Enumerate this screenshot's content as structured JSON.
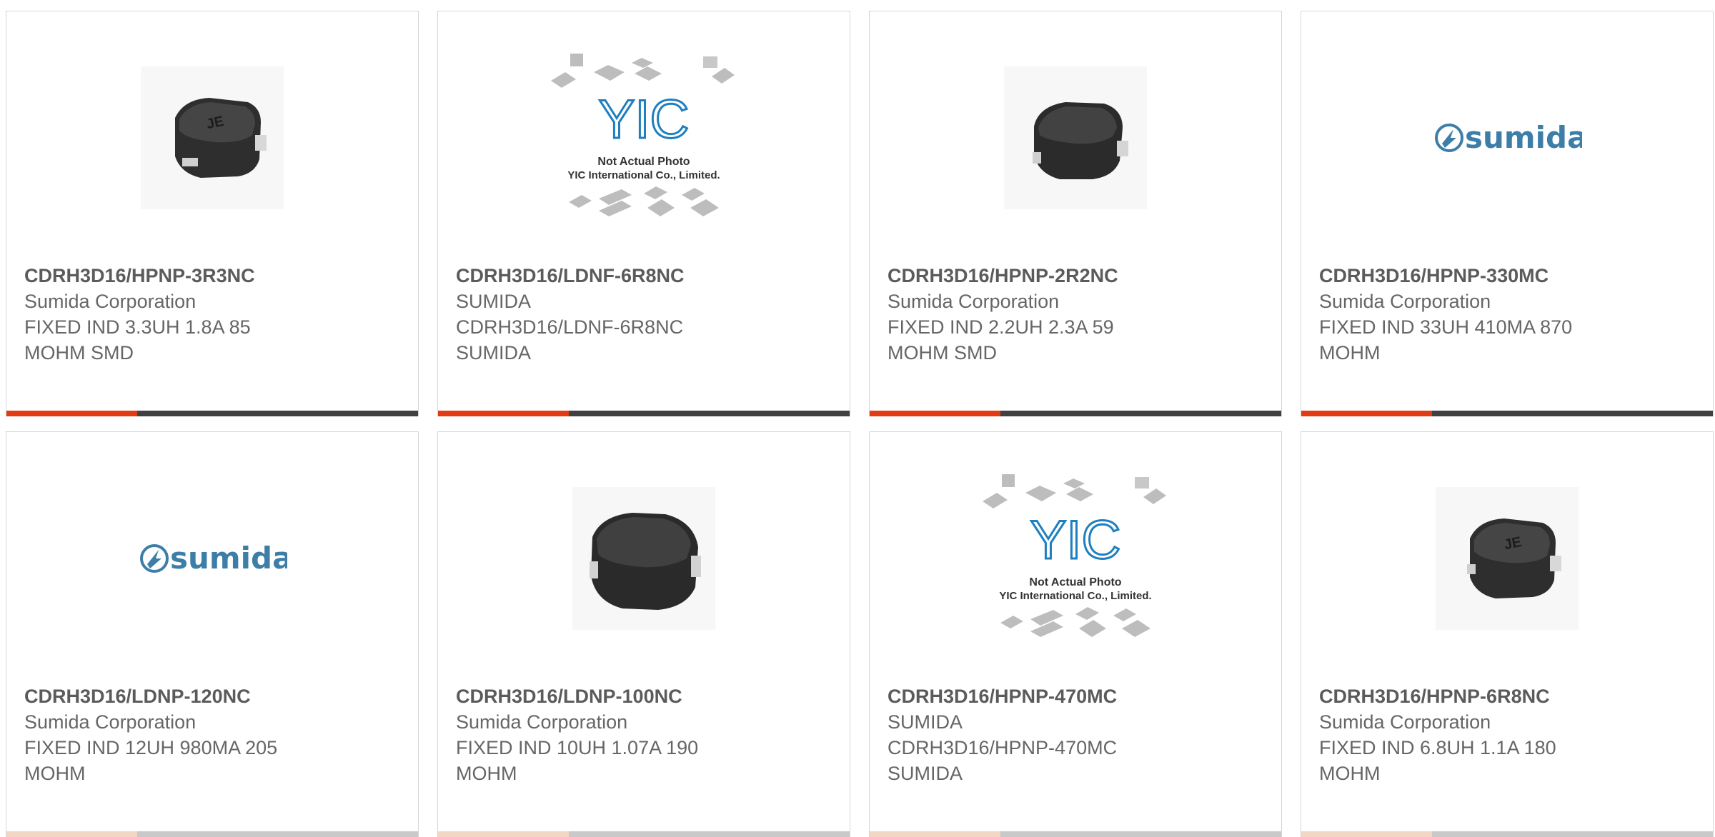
{
  "colors": {
    "accent": "#e23a12",
    "bar_dark": "#404040",
    "text": "#666666",
    "sumida_blue": "#3d7ea8",
    "yic_blue": "#1e7fc0"
  },
  "products": [
    {
      "part_number": "CDRH3D16/HPNP-3R3NC",
      "manufacturer": "Sumida Corporation",
      "desc_line1": "FIXED IND 3.3UH 1.8A 85",
      "desc_line2": "MOHM SMD",
      "image": "inductor-photo",
      "mark": "JE"
    },
    {
      "part_number": "CDRH3D16/LDNF-6R8NC",
      "manufacturer": "SUMIDA",
      "desc_line1": "CDRH3D16/LDNF-6R8NC",
      "desc_line2": "SUMIDA",
      "image": "yic-placeholder"
    },
    {
      "part_number": "CDRH3D16/HPNP-2R2NC",
      "manufacturer": "Sumida Corporation",
      "desc_line1": "FIXED IND 2.2UH 2.3A 59",
      "desc_line2": "MOHM SMD",
      "image": "inductor-photo",
      "mark": ""
    },
    {
      "part_number": "CDRH3D16/HPNP-330MC",
      "manufacturer": "Sumida Corporation",
      "desc_line1": "FIXED IND 33UH 410MA 870",
      "desc_line2": "MOHM",
      "image": "sumida-logo"
    },
    {
      "part_number": "CDRH3D16/LDNP-120NC",
      "manufacturer": "Sumida Corporation",
      "desc_line1": "FIXED IND 12UH 980MA 205",
      "desc_line2": "MOHM",
      "image": "sumida-logo"
    },
    {
      "part_number": "CDRH3D16/LDNP-100NC",
      "manufacturer": "Sumida Corporation",
      "desc_line1": "FIXED IND 10UH 1.07A 190",
      "desc_line2": "MOHM",
      "image": "inductor-photo-large",
      "mark": ""
    },
    {
      "part_number": "CDRH3D16/HPNP-470MC",
      "manufacturer": "SUMIDA",
      "desc_line1": "CDRH3D16/HPNP-470MC",
      "desc_line2": "SUMIDA",
      "image": "yic-placeholder"
    },
    {
      "part_number": "CDRH3D16/HPNP-6R8NC",
      "manufacturer": "Sumida Corporation",
      "desc_line1": "FIXED IND 6.8UH 1.1A 180",
      "desc_line2": "MOHM",
      "image": "inductor-photo",
      "mark": "JE"
    }
  ],
  "yic": {
    "logo_text": "YIC",
    "line1": "Not Actual Photo",
    "line2": "YIC International Co., Limited."
  },
  "sumida": {
    "logo_text": "sumida"
  }
}
